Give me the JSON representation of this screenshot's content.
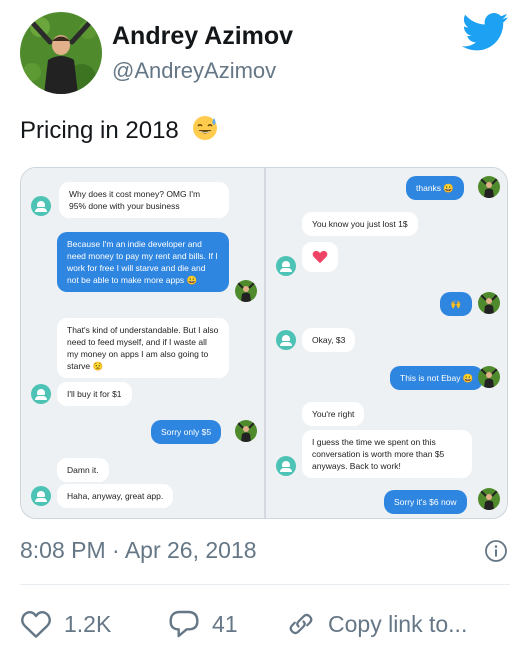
{
  "author": {
    "name": "Andrey Azimov",
    "handle": "@AndreyAzimov"
  },
  "tweet": {
    "text": "Pricing in 2018",
    "emoji": "sweat-smile-emoji"
  },
  "chat_left": [
    {
      "from": "bot",
      "text": "Why does it cost money? OMG I'm 95% done with your business"
    },
    {
      "from": "user",
      "text": "Because I'm an indie developer and need money to pay my rent and bills. If I work for free I will starve and die and not be able to make more apps 😀"
    },
    {
      "from": "bot",
      "text": "That's kind of understandable. But I also need to feed myself, and if I waste all my money on apps I am also going to starve 😟"
    },
    {
      "from": "bot",
      "text": "I'll buy it for $1"
    },
    {
      "from": "user",
      "text": "Sorry only $5"
    },
    {
      "from": "bot",
      "text": "Damn it."
    },
    {
      "from": "bot",
      "text": "Haha, anyway, great app."
    }
  ],
  "chat_right": [
    {
      "from": "user",
      "text": "thanks 😀"
    },
    {
      "from": "bot",
      "text": "You know you just lost 1$"
    },
    {
      "from": "bot",
      "text": "heart-emoji"
    },
    {
      "from": "user",
      "text": "🙌"
    },
    {
      "from": "bot",
      "text": "Okay, $3"
    },
    {
      "from": "user",
      "text": "This is not Ebay 😀"
    },
    {
      "from": "bot",
      "text": "You're right"
    },
    {
      "from": "bot",
      "text": "I guess the time we spent on this conversation is worth more than $5 anyways. Back to work!"
    },
    {
      "from": "user",
      "text": "Sorry it's $6 now"
    }
  ],
  "meta": {
    "timestamp": "8:08 PM · Apr 26, 2018"
  },
  "actions": {
    "likes": "1.2K",
    "replies": "41",
    "copy_link": "Copy link to..."
  },
  "colors": {
    "twitter_blue": "#1da1f2",
    "bubble_out": "#2f86e0",
    "bot_teal": "#4cc3b5",
    "muted_text": "#657786"
  }
}
